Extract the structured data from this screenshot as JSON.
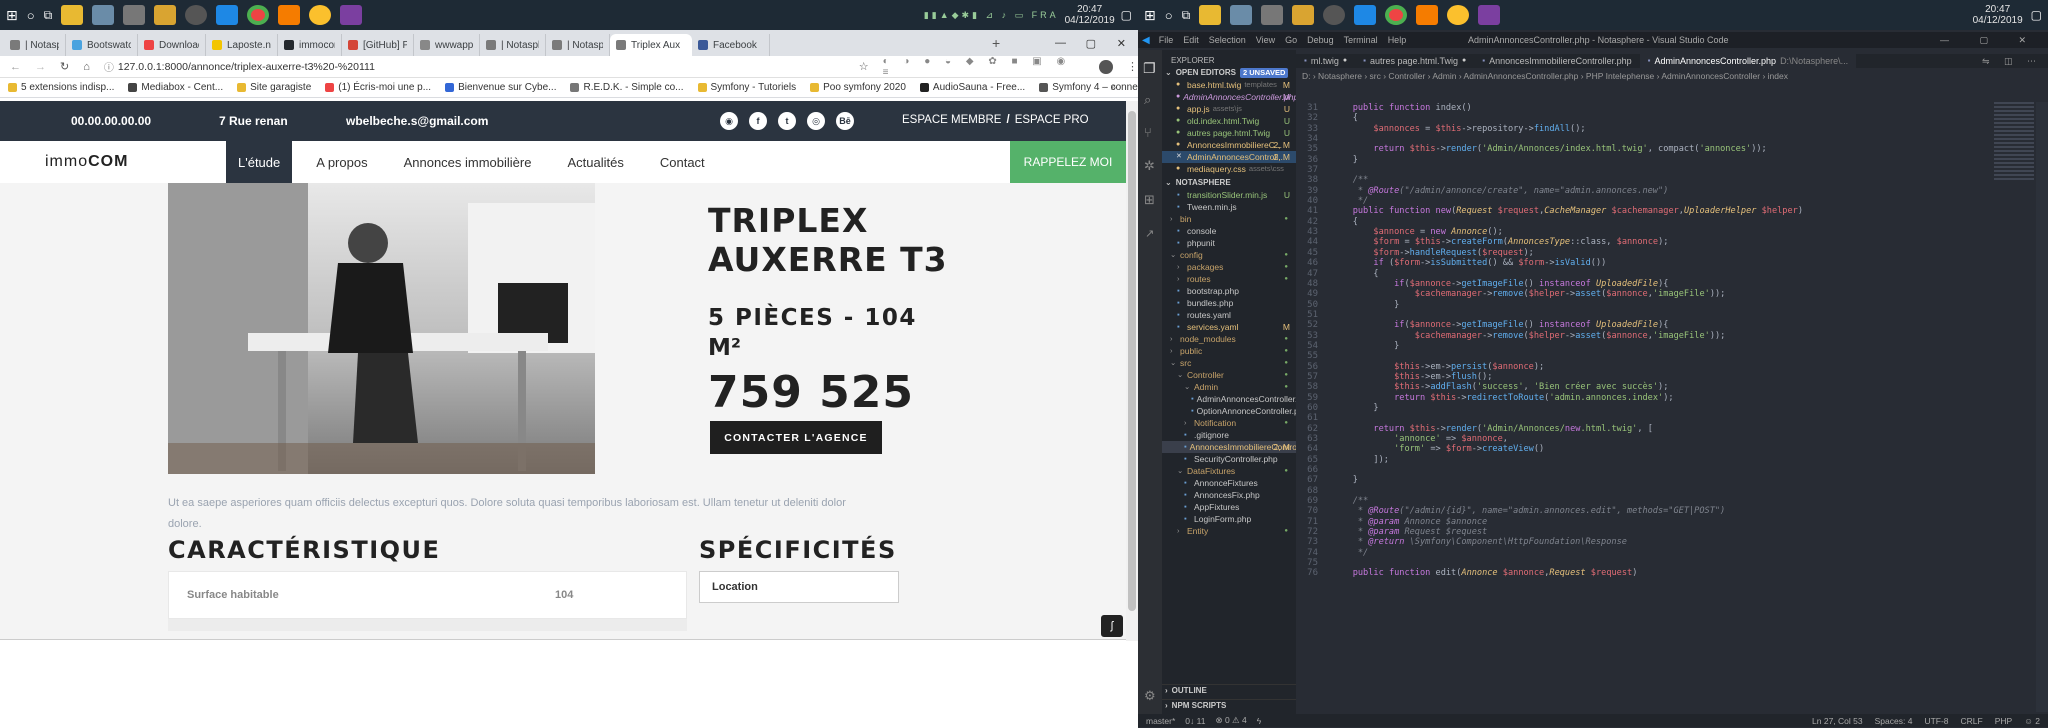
{
  "left": {
    "taskbar": {
      "time": "20:47",
      "date": "04/12/2019"
    },
    "tabs": [
      {
        "label": "| Notasphe",
        "color": "#7a7a7a"
      },
      {
        "label": "Bootswatc",
        "color": "#4aa3df"
      },
      {
        "label": "Download",
        "color": "#e44"
      },
      {
        "label": "Laposte.ne",
        "color": "#f3c500"
      },
      {
        "label": "immocom/",
        "color": "#24292e"
      },
      {
        "label": "[GitHub] Pl",
        "color": "#d44638"
      },
      {
        "label": "wwwapps",
        "color": "#888"
      },
      {
        "label": "| Notasphe",
        "color": "#7a7a7a"
      },
      {
        "label": "| Notasphe",
        "color": "#7a7a7a"
      },
      {
        "label": "Triplex Aux",
        "color": "#7a7a7a",
        "active": true
      },
      {
        "label": "Facebook",
        "color": "#3b5998"
      }
    ],
    "address": "127.0.0.1:8000/annonce/triplex-auxerre-t3%20-%20111",
    "bookmarks": [
      "5 extensions indisp...",
      "Mediabox - Cent...",
      "Site garagiste",
      "(1) Écris-moi une p...",
      "Bienvenue sur Cybe...",
      "R.E.D.K. - Simple co...",
      "Symfony - Tutoriels",
      "Poo symfony 2020",
      "AudioSauna - Free...",
      "Symfony 4 – conne..."
    ],
    "site": {
      "phone": "00.00.00.00.00",
      "address": "7 Rue renan",
      "email": "wbelbeche.s@gmail.com",
      "social": [
        "◉",
        "f",
        "t",
        "◎",
        "Bē"
      ],
      "member": "ESPACE MEMBRE",
      "slash": "/",
      "pro": "ESPACE PRO",
      "logo_a": "immo",
      "logo_b": "COM",
      "nav": [
        "L'étude",
        "A propos",
        "Annonces immobilière",
        "Actualités",
        "Contact"
      ],
      "call": "RAPPELEZ MOI",
      "title_l1": "TRIPLEX",
      "title_l2": "AUXERRE T3",
      "rooms_l1": "5 PIÈCES - 104",
      "rooms_l2": "M²",
      "price": "759 525",
      "contact": "CONTACTER L'AGENCE",
      "desc_l1": "Ut ea saepe asperiores quam officiis delectus excepturi quos. Dolore soluta quasi temporibus laboriosam est. Ullam tenetur ut deleniti dolor",
      "desc_l2": "dolore.",
      "carac": "CARACTÉRISTIQUE",
      "spec": "SPÉCIFICITÉS",
      "surface_label": "Surface habitable",
      "surface_val": "104",
      "location": "Location"
    }
  },
  "right": {
    "taskbar": {
      "time": "20:47",
      "date": "04/12/2019"
    },
    "menu": [
      "File",
      "Edit",
      "Selection",
      "View",
      "Go",
      "Debug",
      "Terminal",
      "Help"
    ],
    "window_title": "AdminAnnoncesController.php - Notasphere - Visual Studio Code",
    "explorer": "EXPLORER",
    "open_editors": "OPEN EDITORS",
    "unsaved": "2 UNSAVED",
    "open_files": [
      {
        "name": "base.html.twig",
        "path": "templates",
        "badge": "M",
        "color": "#e5c07b"
      },
      {
        "name": "AdminAnnoncesController.php",
        "path": "",
        "badge": "M",
        "color": "#c9d",
        "italic": true
      },
      {
        "name": "app.js",
        "path": "assets\\js",
        "badge": "U",
        "color": "#e5c07b"
      },
      {
        "name": "old.index.html.Twig",
        "path": "",
        "badge": "U",
        "color": "#98c379"
      },
      {
        "name": "autres page.html.Twig",
        "path": "",
        "badge": "U",
        "color": "#98c379"
      },
      {
        "name": "AnnoncesImmobiliereC...",
        "path": "",
        "badge": "2, M",
        "color": "#e5c07b"
      },
      {
        "name": "AdminAnnoncesControll...",
        "path": "",
        "badge": "2, M",
        "color": "#e5c07b",
        "selected": true
      },
      {
        "name": "mediaquery.css",
        "path": "assets\\css",
        "badge": "",
        "color": "#e5c07b"
      }
    ],
    "project": "NOTASPHERE",
    "tree": [
      {
        "name": "transitionSlider.min.js",
        "badge": "U",
        "d": 1
      },
      {
        "name": "Tween.min.js",
        "badge": "",
        "d": 1
      },
      {
        "name": "bin",
        "badge": "",
        "d": 0,
        "folder": true
      },
      {
        "name": "console",
        "badge": "",
        "d": 1
      },
      {
        "name": "phpunit",
        "badge": "",
        "d": 1
      },
      {
        "name": "config",
        "badge": "",
        "d": 0,
        "folder": true,
        "open": true
      },
      {
        "name": "packages",
        "badge": "",
        "d": 1,
        "folder": true
      },
      {
        "name": "routes",
        "badge": "",
        "d": 1,
        "folder": true
      },
      {
        "name": "bootstrap.php",
        "badge": "",
        "d": 1
      },
      {
        "name": "bundles.php",
        "badge": "",
        "d": 1
      },
      {
        "name": "routes.yaml",
        "badge": "",
        "d": 1
      },
      {
        "name": "services.yaml",
        "badge": "M",
        "d": 1
      },
      {
        "name": "node_modules",
        "badge": "",
        "d": 0,
        "folder": true
      },
      {
        "name": "public",
        "badge": "",
        "d": 0,
        "folder": true
      },
      {
        "name": "src",
        "badge": "",
        "d": 0,
        "folder": true,
        "open": true
      },
      {
        "name": "Controller",
        "badge": "",
        "d": 1,
        "folder": true,
        "open": true
      },
      {
        "name": "Admin",
        "badge": "",
        "d": 2,
        "folder": true,
        "open": true
      },
      {
        "name": "AdminAnnoncesController.php",
        "badge": "",
        "d": 3
      },
      {
        "name": "OptionAnnonceController.php",
        "badge": "",
        "d": 3
      },
      {
        "name": "Notification",
        "badge": "",
        "d": 2,
        "folder": true
      },
      {
        "name": ".gitignore",
        "badge": "",
        "d": 2
      },
      {
        "name": "AnnoncesImmobiliereControl...",
        "badge": "2, M",
        "d": 2,
        "hl": true
      },
      {
        "name": "SecurityController.php",
        "badge": "",
        "d": 2
      },
      {
        "name": "DataFixtures",
        "badge": "",
        "d": 1,
        "folder": true,
        "open": true
      },
      {
        "name": "AnnonceFixtures",
        "badge": "",
        "d": 2
      },
      {
        "name": "AnnoncesFix.php",
        "badge": "",
        "d": 2
      },
      {
        "name": "AppFixtures",
        "badge": "",
        "d": 2
      },
      {
        "name": "LoginForm.php",
        "badge": "",
        "d": 2
      },
      {
        "name": "Entity",
        "badge": "",
        "d": 1,
        "folder": true
      }
    ],
    "outline": "OUTLINE",
    "npm": "NPM SCRIPTS",
    "tabs": [
      {
        "label": "ml.twig",
        "dot": true
      },
      {
        "label": "autres page.html.Twig",
        "dot": true
      },
      {
        "label": "AnnoncesImmobiliereController.php",
        "dot": false
      },
      {
        "label": "AdminAnnoncesController.php",
        "extra": "D:\\Notasphere\\...",
        "active": true
      }
    ],
    "breadcrumb": "D: › Notasphere › src › Controller › Admin › AdminAnnoncesController.php › PHP Intelephense › AdminAnnoncesController › index",
    "code_start": 31,
    "code": [
      "    public function index()",
      "    {",
      "        $annonces = $this->repository->findAll();",
      "",
      "        return $this->render('Admin/Annonces/index.html.twig', compact('annonces'));",
      "    }",
      "",
      "    /**",
      "     * @Route(\"/admin/annonce/create\", name=\"admin.annonces.new\")",
      "     */",
      "    public function new(Request $request,CacheManager $cachemanager,UploaderHelper $helper)",
      "    {",
      "        $annonce = new Annonce();",
      "        $form = $this->createForm(AnnoncesType::class, $annonce);",
      "        $form->handleRequest($request);",
      "        if ($form->isSubmitted() && $form->isValid())",
      "        {",
      "            if($annonce->getImageFile() instanceof UploadedFile){",
      "                $cachemanager->remove($helper->asset($annonce,'imageFile'));",
      "            }",
      "",
      "            if($annonce->getImageFile() instanceof UploadedFile){",
      "                $cachemanager->remove($helper->asset($annonce,'imageFile'));",
      "            }",
      "",
      "            $this->em->persist($annonce);",
      "            $this->em->flush();",
      "            $this->addFlash('success', 'Bien créer avec succès');",
      "            return $this->redirectToRoute('admin.annonces.index');",
      "        }",
      "",
      "        return $this->render('Admin/Annonces/new.html.twig', [",
      "            'annonce' => $annonce,",
      "            'form' => $form->createView()",
      "        ]);",
      "",
      "    }",
      "",
      "    /**",
      "     * @Route(\"/admin/{id}\", name=\"admin.annonces.edit\", methods=\"GET|POST\")",
      "     * @param Annonce $annonce",
      "     * @param Request $request",
      "     * @return \\Symfony\\Component\\HttpFoundation\\Response",
      "     */",
      "",
      "    public function edit(Annonce $annonce,Request $request)"
    ],
    "status": {
      "branch": "master*",
      "sync": "0↓ 11",
      "problems": "⊗ 0  ⚠ 4",
      "pos": "Ln 27, Col 53",
      "spaces": "Spaces: 4",
      "enc": "UTF-8",
      "eol": "CRLF",
      "lang": "PHP",
      "misc": "☺ 2"
    }
  },
  "colors": {
    "site_dark": "#2b3440",
    "call_green": "#55b26a",
    "vs_bg": "#282c34"
  }
}
